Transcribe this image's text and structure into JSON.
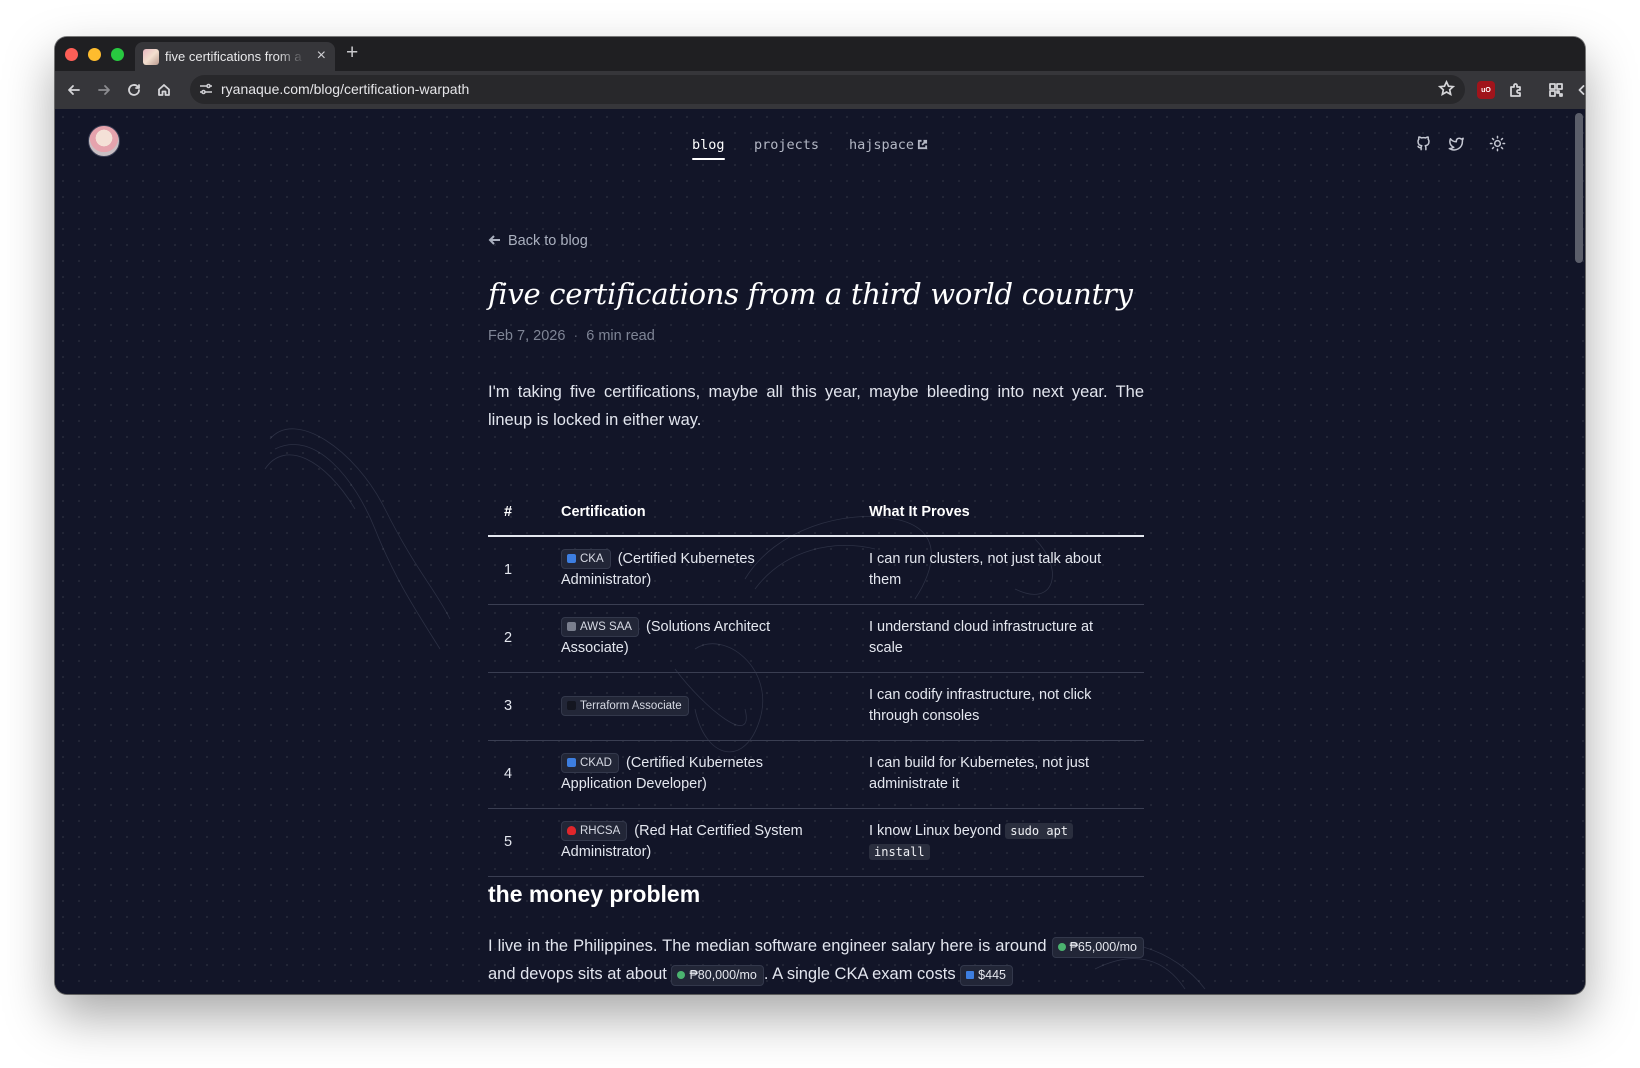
{
  "browser": {
    "tab_title": "five certifications from a third world country",
    "url": "ryanaque.com/blog/certification-warpath",
    "extension_badge": "uO"
  },
  "site": {
    "nav": [
      {
        "label": "blog",
        "active": true
      },
      {
        "label": "projects",
        "active": false
      },
      {
        "label": "hajspace",
        "active": false,
        "external": true
      }
    ],
    "icons": [
      "github-icon",
      "twitter-icon",
      "sun-icon"
    ]
  },
  "post": {
    "back_label": "Back to blog",
    "title": "five certifications from a third world country",
    "date": "Feb 7, 2026",
    "separator": "·",
    "read_time": "6 min read",
    "intro": "I'm taking five certifications, maybe all this year, maybe bleeding into next year. The lineup is locked in either way.",
    "table": {
      "headers": [
        "#",
        "Certification",
        "What It Proves"
      ],
      "rows": [
        {
          "num": "1",
          "badge": "CKA",
          "icon": "kubernetes-icon",
          "rest": "(Certified Kubernetes Administrator)",
          "proves": "I can run clusters, not just talk about them"
        },
        {
          "num": "2",
          "badge": "AWS SAA",
          "icon": "aws-icon",
          "rest": "(Solutions Architect Associate)",
          "proves": "I understand cloud infrastructure at scale"
        },
        {
          "num": "3",
          "badge": "Terraform Associate",
          "icon": "terraform-icon",
          "rest": "",
          "proves": "I can codify infrastructure, not click through consoles"
        },
        {
          "num": "4",
          "badge": "CKAD",
          "icon": "kubernetes-icon",
          "rest": "(Certified Kubernetes Application Developer)",
          "proves": "I can build for Kubernetes, not just administrate it"
        },
        {
          "num": "5",
          "badge": "RHCSA",
          "icon": "redhat-icon",
          "rest": "(Red Hat Certified System Administrator)",
          "proves_prefix": "I know Linux beyond",
          "proves_code_1": "sudo apt",
          "proves_code_2": "install"
        }
      ]
    },
    "section_heading": "the money problem",
    "para2": {
      "text_1": "I live in the Philippines. The median software engineer salary here is around",
      "chip_1": "₱65,000/mo",
      "text_2": "and devops sits at about",
      "chip_2": "₱80,000/mo",
      "text_3": ". A single CKA exam costs",
      "chip_3": "$445"
    }
  }
}
